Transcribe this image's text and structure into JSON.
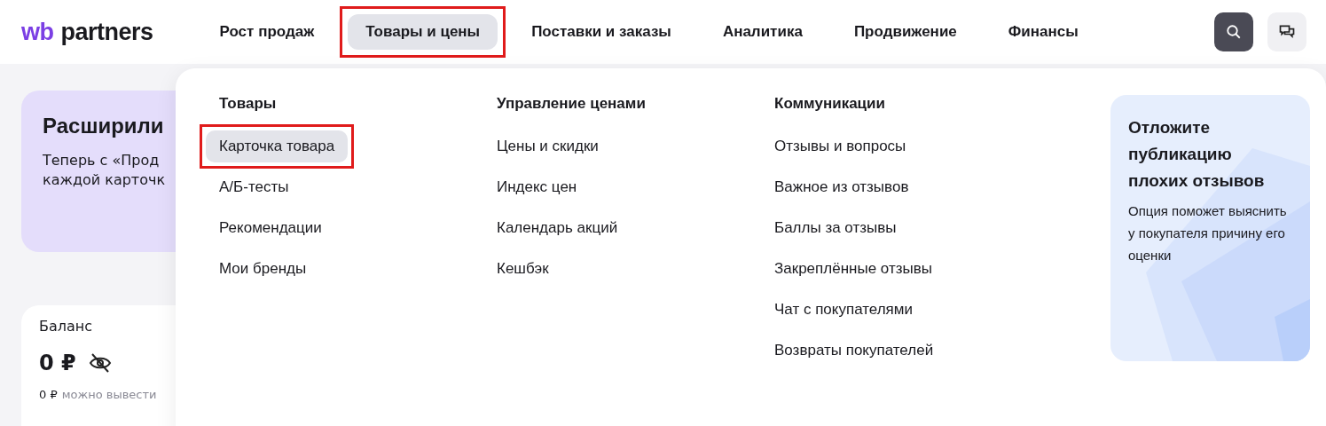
{
  "logo": {
    "brand": "wb",
    "name": "partners"
  },
  "nav": [
    {
      "label": "Рост продаж",
      "selected": false,
      "highlighted": false
    },
    {
      "label": "Товары и цены",
      "selected": true,
      "highlighted": true
    },
    {
      "label": "Поставки и заказы",
      "selected": false,
      "highlighted": false
    },
    {
      "label": "Аналитика",
      "selected": false,
      "highlighted": false
    },
    {
      "label": "Продвижение",
      "selected": false,
      "highlighted": false
    },
    {
      "label": "Финансы",
      "selected": false,
      "highlighted": false
    }
  ],
  "background": {
    "promo": {
      "title": "Расширили",
      "text": "Теперь с «Прод каждой карточк"
    },
    "balance": {
      "label": "Баланс",
      "amount": "0 ₽",
      "available_amount": "0 ₽",
      "available_label": "можно вывести"
    }
  },
  "menu": {
    "columns": [
      {
        "title": "Товары",
        "items": [
          {
            "label": "Карточка товара",
            "selected": true,
            "highlighted": true
          },
          {
            "label": "А/Б-тесты",
            "selected": false,
            "highlighted": false
          },
          {
            "label": "Рекомендации",
            "selected": false,
            "highlighted": false
          },
          {
            "label": "Мои бренды",
            "selected": false,
            "highlighted": false
          }
        ]
      },
      {
        "title": "Управление ценами",
        "items": [
          {
            "label": "Цены и скидки",
            "selected": false,
            "highlighted": false
          },
          {
            "label": "Индекс цен",
            "selected": false,
            "highlighted": false
          },
          {
            "label": "Календарь акций",
            "selected": false,
            "highlighted": false
          },
          {
            "label": "Кешбэк",
            "selected": false,
            "highlighted": false
          }
        ]
      },
      {
        "title": "Коммуникации",
        "items": [
          {
            "label": "Отзывы и вопросы",
            "selected": false,
            "highlighted": false
          },
          {
            "label": "Важное из отзывов",
            "selected": false,
            "highlighted": false
          },
          {
            "label": "Баллы за отзывы",
            "selected": false,
            "highlighted": false
          },
          {
            "label": "Закреплённые отзывы",
            "selected": false,
            "highlighted": false
          },
          {
            "label": "Чат с покупателями",
            "selected": false,
            "highlighted": false
          },
          {
            "label": "Возвраты покупателей",
            "selected": false,
            "highlighted": false
          }
        ]
      }
    ],
    "promo": {
      "title": "Отложите публикацию плохих отзывов",
      "text": "Опция поможет выяснить\nу покупателя причину его оценки"
    }
  }
}
